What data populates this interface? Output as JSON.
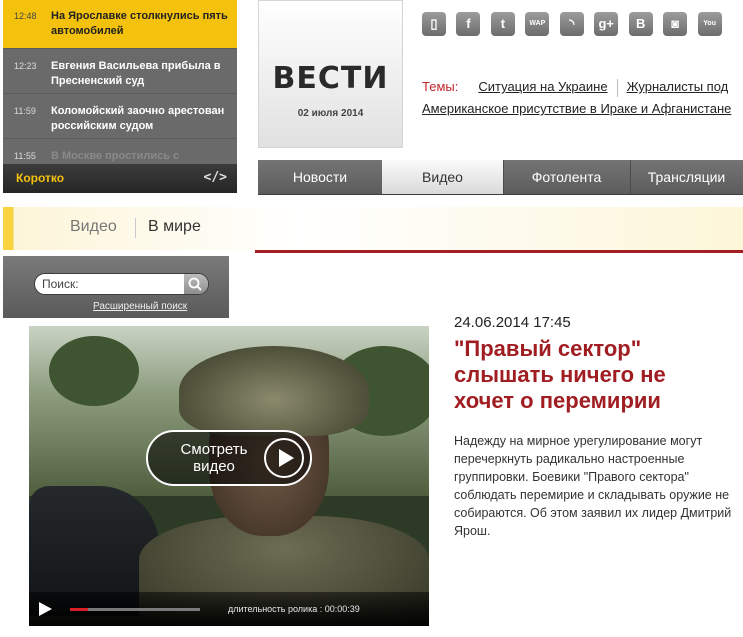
{
  "ticker": {
    "items": [
      {
        "time": "12:48",
        "text": "На Ярославке столкнулись пять автомобилей"
      },
      {
        "time": "12:23",
        "text": "Евгения Васильева прибыла в Пресненский суд"
      },
      {
        "time": "11:59",
        "text": "Коломойский заочно арестован российским судом"
      },
      {
        "time": "11:55",
        "text": "В Москве простились с"
      }
    ],
    "bar_label": "Коротко",
    "embed_label": "</>"
  },
  "logo": {
    "word": "ВЕСТИ",
    "date": "02 июля 2014"
  },
  "social": {
    "icons": [
      {
        "name": "mobile-icon",
        "glyph": "▯"
      },
      {
        "name": "facebook-icon",
        "glyph": "f"
      },
      {
        "name": "twitter-icon",
        "glyph": "t"
      },
      {
        "name": "wap-icon",
        "glyph": "WAP"
      },
      {
        "name": "rss-icon",
        "glyph": "◝"
      },
      {
        "name": "google-plus-icon",
        "glyph": "g+"
      },
      {
        "name": "vkontakte-icon",
        "glyph": "B"
      },
      {
        "name": "instagram-icon",
        "glyph": "◙"
      },
      {
        "name": "youtube-icon",
        "glyph": "You"
      }
    ]
  },
  "topics": {
    "label": "Темы:",
    "links": [
      "Ситуация на Украине",
      "Журналисты под",
      "Американское присутствие в Ираке и Афганистане"
    ]
  },
  "nav": {
    "tabs": [
      "Новости",
      "Видео",
      "Фотолента",
      "Трансляции"
    ],
    "active": "Видео"
  },
  "breadcrumb": {
    "section": "Видео",
    "subsection": "В мире"
  },
  "search": {
    "placeholder": "Поиск:",
    "advanced": "Расширенный поиск"
  },
  "video": {
    "play_label": "Смотреть видео",
    "duration_label": "длительность ролика : 00:00:39",
    "progress": 0.14
  },
  "article": {
    "date": "24.06.2014 17:45",
    "title": "\"Правый сектор\" слышать ничего не хочет о перемирии",
    "lead": "Надежду на мирное урегулирование могут перечеркнуть радикально настроенные группировки. Боевики \"Правого сектора\" соблюдать перемирие и складывать оружие не собираются. Об этом заявил их лидер Дмитрий Ярош."
  }
}
